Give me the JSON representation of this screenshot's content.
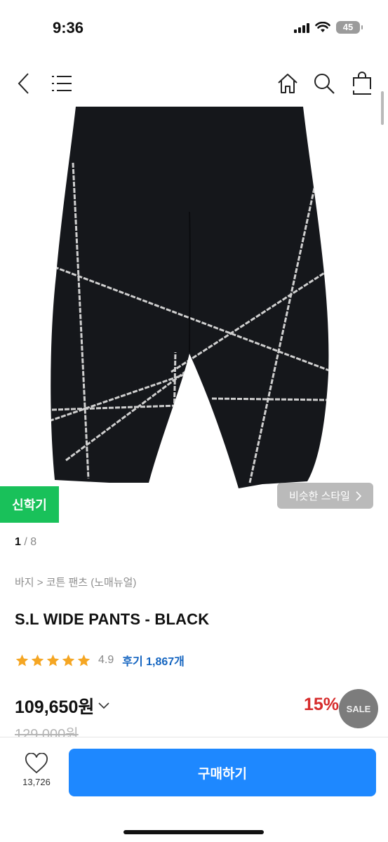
{
  "status": {
    "time": "9:36",
    "battery": "45"
  },
  "nav": {
    "icons": [
      "back-icon",
      "menu-icon",
      "home-icon",
      "search-icon",
      "bag-icon"
    ]
  },
  "gallery": {
    "badge": "신학기",
    "similar_label": "비슷한 스타일",
    "current": "1",
    "separator": " / ",
    "total": "8"
  },
  "product": {
    "breadcrumb": "바지 > 코튼 팬츠 (노매뉴얼)",
    "name": "S.L WIDE PANTS - BLACK",
    "rating": "4.9",
    "stars": 5,
    "review_label": "후기 1,867개",
    "price": "109,650원",
    "discount": "15%",
    "sale_badge": "SALE",
    "original_price": "129,000원"
  },
  "bottom": {
    "like_count": "13,726",
    "buy_label": "구매하기"
  },
  "colors": {
    "accent": "#1e88ff",
    "badge_green": "#19c15a",
    "discount_red": "#d62b2b",
    "star": "#f5a623",
    "review_blue": "#1565c0"
  }
}
